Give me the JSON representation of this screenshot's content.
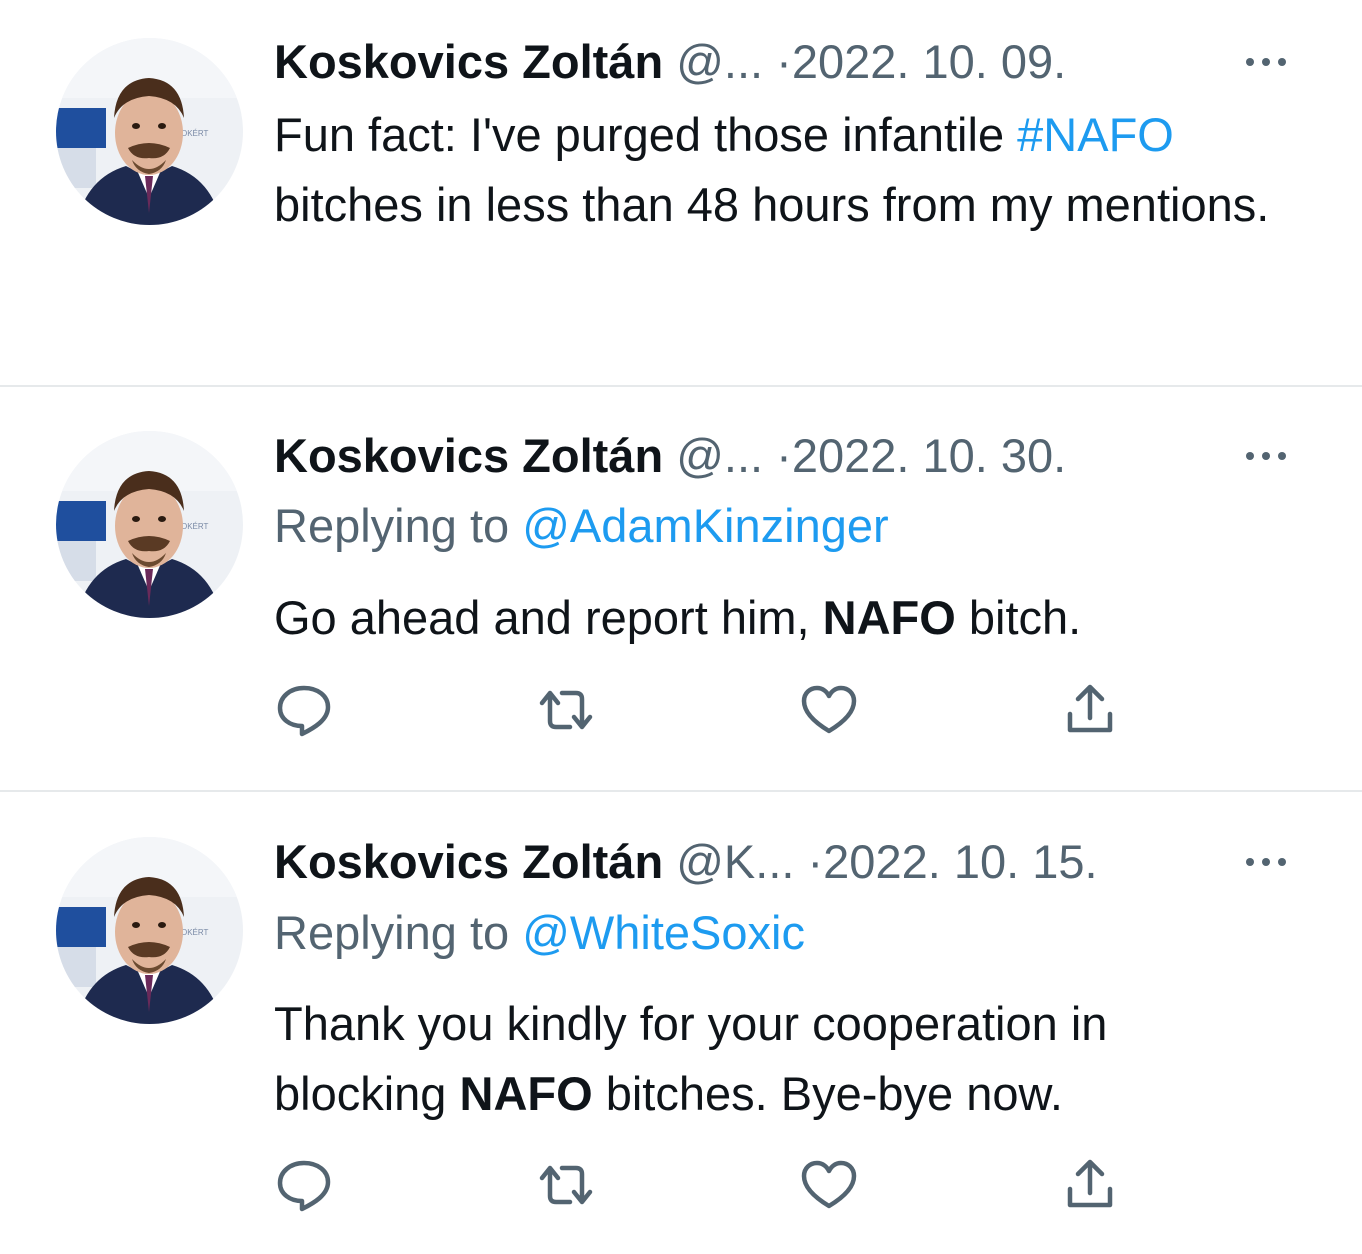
{
  "colors": {
    "text": "#0f1419",
    "secondary": "#536471",
    "accent": "#1d9bf0",
    "divider": "#e6e9eb"
  },
  "tweets": [
    {
      "name": "Koskovics Zoltán",
      "handle": "@...",
      "separator": "·",
      "date": "2022. 10. 09.",
      "more_icon": "more-dots-icon",
      "body_parts": {
        "p1": "Fun fact: I've purged those infantile ",
        "hashtag": "#NAFO",
        "p2": " bitches in less than 48 hours from my mentions."
      }
    },
    {
      "name": "Koskovics Zoltán",
      "handle": "@...",
      "separator": "·",
      "date": "2022. 10. 30.",
      "replying_label": "Replying to ",
      "replying_to": "@AdamKinzinger",
      "body_parts": {
        "p1": "Go ahead and report him, ",
        "bold": "NAFO",
        "p2": " bitch."
      },
      "actions": [
        "reply-icon",
        "retweet-icon",
        "like-icon",
        "share-icon"
      ]
    },
    {
      "name": "Koskovics Zoltán",
      "handle": "@K...",
      "separator": "·",
      "date": "2022. 10. 15.",
      "replying_label": "Replying to ",
      "replying_to": "@WhiteSoxic",
      "body_parts": {
        "p1": "Thank you kindly for your cooperation in blocking ",
        "bold": "NAFO",
        "p2": " bitches. Bye-bye now."
      },
      "actions": [
        "reply-icon",
        "retweet-icon",
        "like-icon",
        "share-icon"
      ]
    }
  ]
}
